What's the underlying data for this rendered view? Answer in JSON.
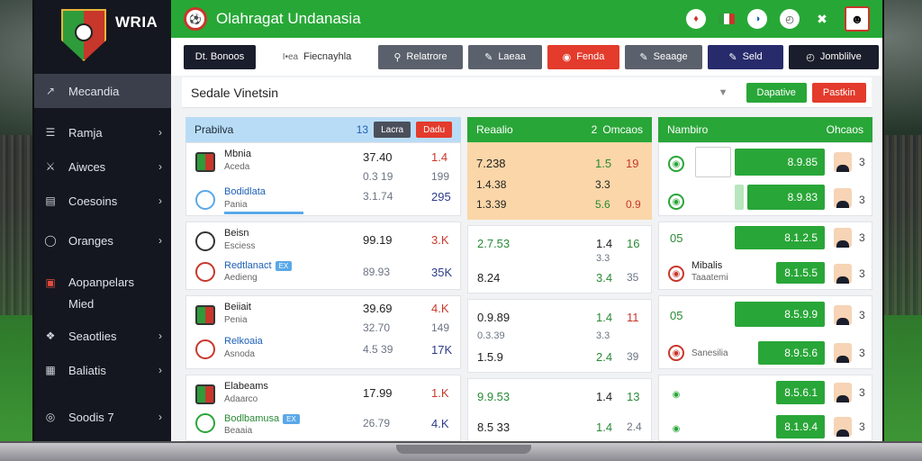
{
  "brand": "WRIA",
  "sidebar": {
    "items": [
      {
        "icon": "↗",
        "label": "Mecandia",
        "chevron": false,
        "icon_name": "trend-icon"
      },
      {
        "icon": "☰",
        "label": "Ramja",
        "chevron": true,
        "icon_name": "list-icon"
      },
      {
        "icon": "⚔",
        "label": "Aiwces",
        "chevron": true,
        "icon_name": "sword-icon"
      },
      {
        "icon": "▤",
        "label": "Coesoins",
        "chevron": true,
        "icon_name": "table-icon"
      },
      {
        "icon": "◯",
        "label": "Oranges",
        "chevron": true,
        "icon_name": "ball-icon"
      },
      {
        "icon": "▣",
        "label": "Aopanpelars",
        "label2": "Mied",
        "chevron": false,
        "icon_name": "card-icon"
      },
      {
        "icon": "❖",
        "label": "Seaotlies",
        "chevron": true,
        "icon_name": "grid-icon"
      },
      {
        "icon": "▦",
        "label": "Baliatis",
        "chevron": true,
        "icon_name": "calendar-icon"
      },
      {
        "icon": "◎",
        "label": "Soodis 7",
        "chevron": true,
        "icon_name": "target-icon"
      }
    ]
  },
  "header": {
    "title": "Olahragat Undanasia"
  },
  "toolbar": {
    "b1": "Dt. Bonoos",
    "b2": "Fiecnayhla",
    "b2_prefix": "I•ea",
    "b3": "Relatrore",
    "b4": "Laeaa",
    "b5": "Fenda",
    "b6": "Seaage",
    "b7": "Seld",
    "b8": "Jomblilve"
  },
  "search": {
    "value": "Sedale Vinetsin",
    "btn_green": "Dapative",
    "btn_red": "Pastkin"
  },
  "col1": {
    "title": "Prabilva",
    "count": "13",
    "btn_dark": "Lacra",
    "btn_red": "Dadu",
    "rows": [
      {
        "name": "Mbnia",
        "sub": "Aceda",
        "v1": "37.40",
        "v2": "1.4",
        "v1b": "0.3 19",
        "v2b": "199"
      },
      {
        "name": "Bodidlata",
        "sub": "Pania",
        "v1": "3.1.74",
        "v2": "295"
      },
      {
        "name": "Beisn",
        "sub": "Esciess",
        "v1": "99.19",
        "v2": "3.K"
      },
      {
        "name": "Redtlanact",
        "sub": "Aedieng",
        "v1": "89.93",
        "v2": "35K",
        "badge": "EX"
      },
      {
        "name": "Beiiait",
        "sub": "Penia",
        "v1": "39.69",
        "v2": "4.K",
        "v1b": "32.70",
        "v2b": "149"
      },
      {
        "name": "Relkoaia",
        "sub": "Asnoda",
        "v1": "4.5 39",
        "v2": "17K"
      },
      {
        "name": "Elabeams",
        "sub": "Adaarco",
        "v1": "17.99",
        "v2": "1.K"
      },
      {
        "name": "Bodlbamusa",
        "sub": "Beaaia",
        "v1": "26.79",
        "v2": "4.K",
        "badge": "EX"
      }
    ]
  },
  "col2": {
    "title": "Reaalio",
    "count": "2",
    "label": "Omcaos",
    "rows": [
      {
        "a": "7.238",
        "b": "1.5",
        "c": "19",
        "a2": "1.4.38",
        "b2": "3.3",
        "a3": "1.3.39",
        "b3": "5.6",
        "c3": "0.9"
      },
      {
        "a": "2.7.53",
        "b": "1.4",
        "c": "16",
        "b2": "3.3",
        "a3": "8.24",
        "b3": "3.4",
        "c3": "35"
      },
      {
        "a": "0.9.89",
        "b": "1.4",
        "c": "11",
        "a2": "0.3.39",
        "b2": "3.3",
        "a3": "1.5.9",
        "b3": "2.4",
        "c3": "39"
      },
      {
        "a": "9.9.53",
        "b": "1.4",
        "c": "13",
        "a3": "8.5 33",
        "b3": "1.4",
        "c3": "2.4"
      }
    ]
  },
  "col3": {
    "title": "Nambiro",
    "label": "Ohcaos",
    "rows": [
      {
        "v": "8.9.85",
        "c": "3",
        "sub": "",
        "kind": "circle"
      },
      {
        "v": "8.9.83",
        "c": "3",
        "sub": "",
        "kind": "circle"
      },
      {
        "v": "8.1.2.5",
        "c": "3",
        "sub": "",
        "kind": "text",
        "text": "05"
      },
      {
        "v": "8.1.5.5",
        "c": "3",
        "sub": "Taaatemi",
        "kind": "red",
        "name": "Mibalis"
      },
      {
        "v": "8.5.9.9",
        "c": "3",
        "sub": "",
        "kind": "text",
        "text": "05"
      },
      {
        "v": "8.9.5.6",
        "c": "3",
        "sub": "Sanesilia",
        "kind": "red"
      },
      {
        "v": "8.5.6.1",
        "c": "3",
        "sub": "",
        "kind": "circle"
      },
      {
        "v": "8.1.9.4",
        "c": "3",
        "sub": "",
        "kind": "circle"
      }
    ]
  }
}
